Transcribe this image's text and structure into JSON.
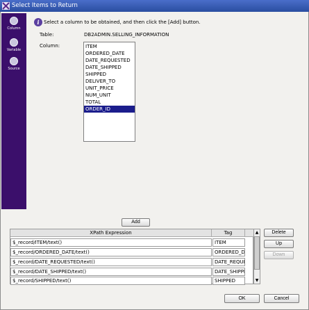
{
  "window": {
    "title": "Select Items to Return"
  },
  "sidebar": {
    "items": [
      {
        "label": "Column",
        "icon": "column-icon"
      },
      {
        "label": "Variable",
        "icon": "variable-icon"
      },
      {
        "label": "Source",
        "icon": "source-icon"
      }
    ]
  },
  "instruction": "Select a column to be obtained, and then click the [Add] button.",
  "form": {
    "table_label": "Table:",
    "table_value": "DB2ADMIN.SELLING_INFORMATION",
    "column_label": "Column:"
  },
  "columns": {
    "options": [
      "ITEM",
      "ORDERED_DATE",
      "DATE_REQUESTED",
      "DATE_SHIPPED",
      "SHIPPED",
      "DELIVER_TO",
      "UNIT_PRICE",
      "NUM_UNIT",
      "TOTAL",
      "ORDER_ID"
    ],
    "selected": "ORDER_ID"
  },
  "buttons": {
    "add": "Add",
    "delete": "Delete",
    "up": "Up",
    "down": "Down",
    "ok": "OK",
    "cancel": "Cancel"
  },
  "grid": {
    "headers": [
      "XPath Expression",
      "Tag"
    ],
    "rows": [
      {
        "xpath": "$_record/ITEM/text()",
        "tag": "ITEM"
      },
      {
        "xpath": "$_record/ORDERED_DATE/text()",
        "tag": "ORDERED_DAT"
      },
      {
        "xpath": "$_record/DATE_REQUESTED/text()",
        "tag": "DATE_REQUES"
      },
      {
        "xpath": "$_record/DATE_SHIPPED/text()",
        "tag": "DATE_SHIPPED"
      },
      {
        "xpath": "$_record/SHIPPED/text()",
        "tag": "SHIPPED"
      }
    ]
  },
  "colors": {
    "sidebar": "#3b0f6b",
    "selection": "#1b1d8c",
    "titlebar": "#2a4da0"
  }
}
